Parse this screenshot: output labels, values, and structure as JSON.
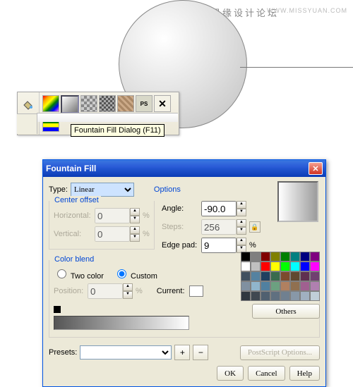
{
  "watermark": {
    "cn": "思缘设计论坛",
    "url": "WWW.MISSYUAN.COM"
  },
  "toolbar": {
    "tooltip": "Fountain Fill Dialog (F11)",
    "icons": [
      "bucket",
      "bucket",
      "rainbow",
      "gradient",
      "pattern",
      "checker",
      "texture",
      "ps",
      "x",
      "bars"
    ]
  },
  "dialog": {
    "title": "Fountain Fill",
    "type_label": "Type:",
    "type_value": "Linear",
    "center_offset": "Center offset",
    "horizontal": "Horizontal:",
    "vertical": "Vertical:",
    "h_val": "0",
    "v_val": "0",
    "pct": "%",
    "options": "Options",
    "angle": "Angle:",
    "angle_val": "-90.0",
    "steps": "Steps:",
    "steps_val": "256",
    "edgepad": "Edge pad:",
    "edgepad_val": "9",
    "color_blend": "Color blend",
    "two_color": "Two color",
    "custom": "Custom",
    "position": "Position:",
    "pos_val": "0",
    "current": "Current:",
    "others": "Others",
    "presets": "Presets:",
    "postscript": "PostScript Options...",
    "ok": "OK",
    "cancel": "Cancel",
    "help": "Help",
    "palette": [
      [
        "#000000",
        "#7f7f7f",
        "#800000",
        "#808000",
        "#008000",
        "#008080",
        "#000080",
        "#800080"
      ],
      [
        "#ffffff",
        "#c0c0c0",
        "#ff0000",
        "#ffff00",
        "#00ff00",
        "#00ffff",
        "#0000ff",
        "#ff00ff"
      ],
      [
        "#405060",
        "#5582a0",
        "#204060",
        "#3a6b4e",
        "#7c4a2d",
        "#604830",
        "#603050",
        "#704070"
      ],
      [
        "#8090a0",
        "#90b5cc",
        "#5080a0",
        "#6ca080",
        "#b08060",
        "#907050",
        "#a06090",
        "#b080b0"
      ],
      [
        "#303840",
        "#404850",
        "#506070",
        "#607080",
        "#708090",
        "#8898a8",
        "#a0b0c0",
        "#c0cfd8"
      ]
    ]
  }
}
